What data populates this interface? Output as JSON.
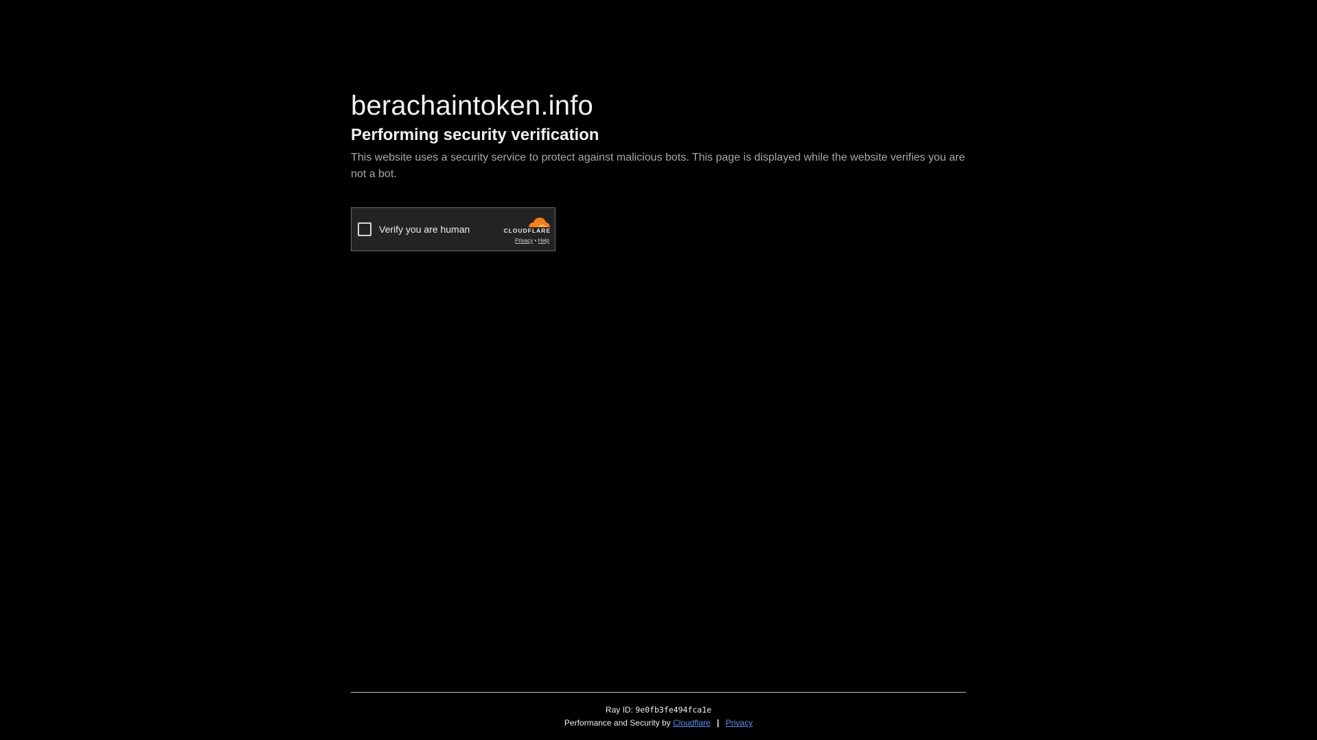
{
  "site": {
    "domain": "berachaintoken.info"
  },
  "verification": {
    "heading": "Performing security verification",
    "description": "This website uses a security service to protect against malicious bots. This page is displayed while the website verifies you are not a bot."
  },
  "widget": {
    "checkbox_label": "Verify you are human",
    "brand": "CLOUDFLARE",
    "privacy_link": "Privacy",
    "link_separator": "•",
    "help_link": "Help",
    "brand_color": "#f38020"
  },
  "footer": {
    "ray_label": "Ray ID:",
    "ray_id": "9e0fb3fe494fca1e",
    "performance_text": "Performance and Security by",
    "cloudflare_link": "Cloudflare",
    "separator": "|",
    "privacy_link": "Privacy"
  },
  "colors": {
    "background": "#000000",
    "link": "#5f8ff0",
    "widget_background": "#232323"
  }
}
